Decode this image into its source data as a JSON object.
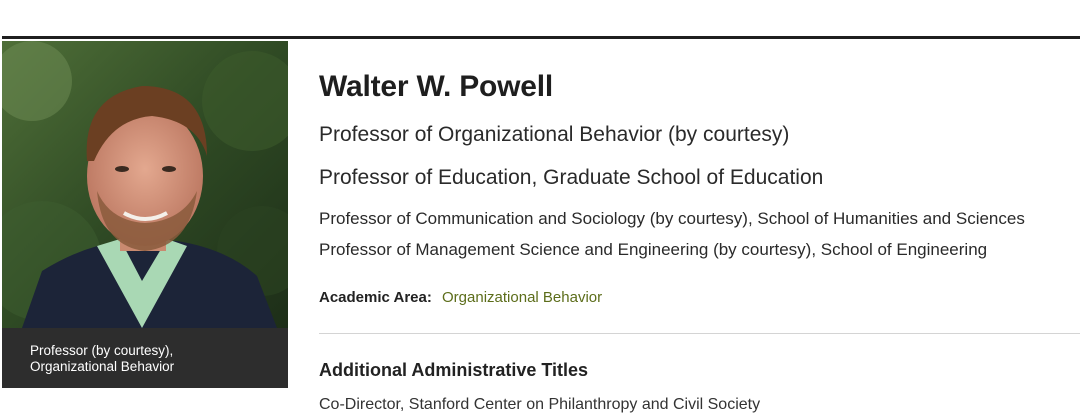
{
  "profile": {
    "photo_alt": "Walter W. Powell",
    "caption_line1": "Professor (by courtesy),",
    "caption_line2": "Organizational Behavior",
    "name": "Walter W. Powell",
    "titles_primary": [
      "Professor of Organizational Behavior (by courtesy)",
      "Professor of Education, Graduate School of Education"
    ],
    "titles_secondary": [
      "Professor of Communication and Sociology (by courtesy), School of Humanities and Sciences",
      "Professor of Management Science and Engineering (by courtesy), School of Engineering"
    ],
    "academic_area_label": "Academic Area:",
    "academic_area_value": "Organizational Behavior",
    "additional_titles_heading": "Additional Administrative Titles",
    "additional_titles_first": "Co-Director, Stanford Center on Philanthropy and Civil Society"
  },
  "colors": {
    "link": "#5c6d1a",
    "caption_bg": "#2d2d2d",
    "rule": "#1f1f1f"
  }
}
